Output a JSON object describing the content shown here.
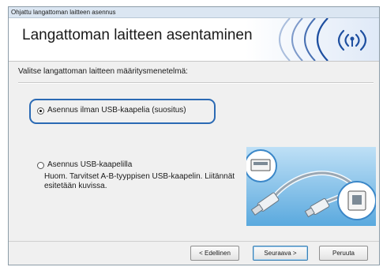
{
  "window": {
    "title": "Ohjattu langattoman laitteen asennus"
  },
  "banner": {
    "heading": "Langattoman laitteen asentaminen",
    "logo_icon": "wireless-signal-icon",
    "accent_color": "#1e4fa0"
  },
  "main": {
    "prompt": "Valitse langattoman laitteen määritysmenetelmä:",
    "options": [
      {
        "label": "Asennus ilman USB-kaapelia (suositus)",
        "selected": true
      },
      {
        "label": "Asennus USB-kaapelilla",
        "selected": false
      }
    ],
    "usb_note": "Huom. Tarvitset A-B-tyyppisen USB-kaapelin. Liitännät esitetään kuvissa.",
    "illustration_icon": "usb-a-b-cable-icon",
    "highlight_color": "#2b6ab4"
  },
  "footer": {
    "back_label": "< Edellinen",
    "next_label": "Seuraava >",
    "cancel_label": "Peruuta"
  }
}
